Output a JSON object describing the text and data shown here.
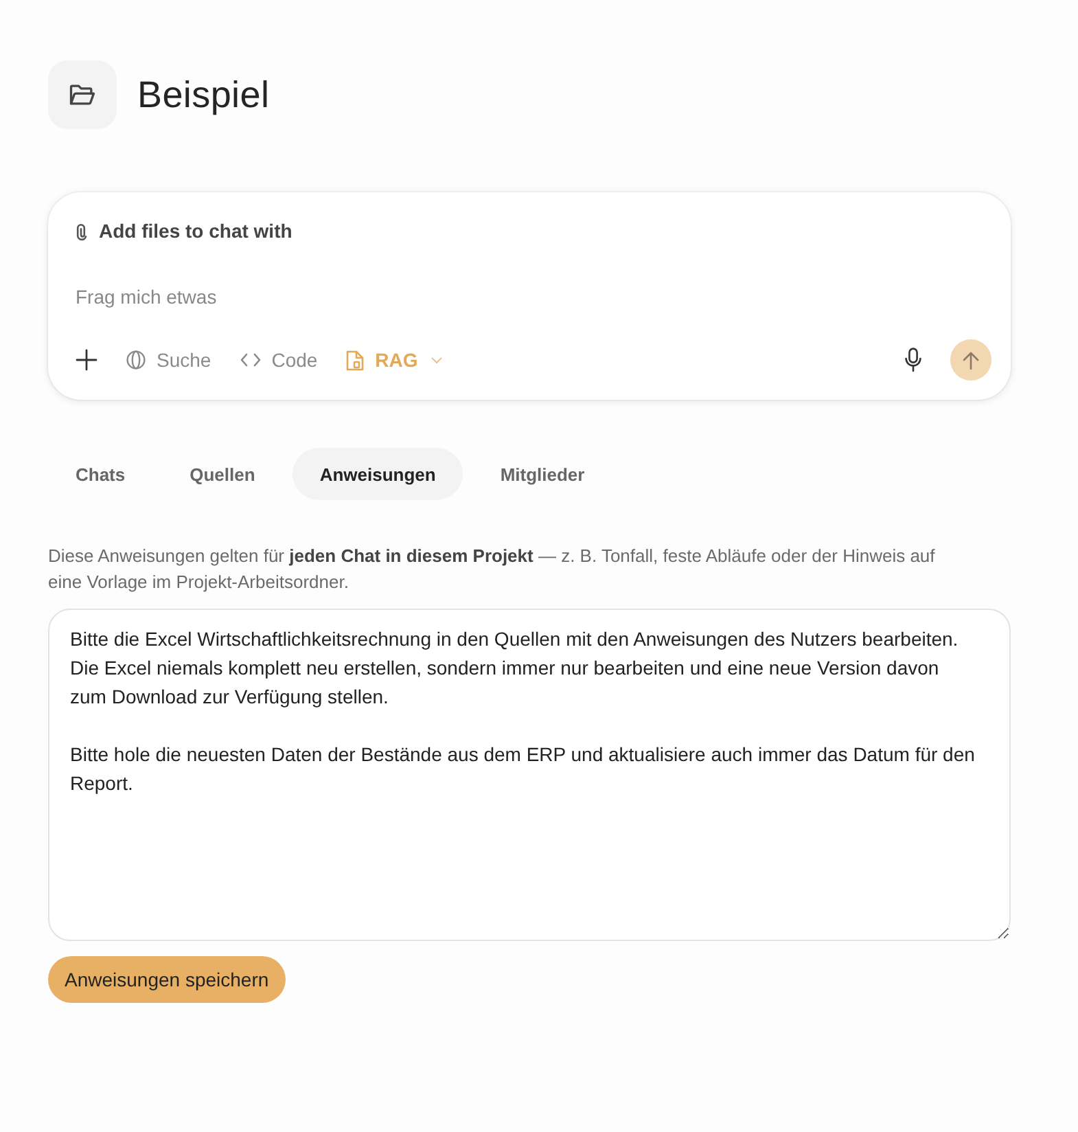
{
  "project": {
    "title": "Beispiel"
  },
  "composer": {
    "attach_label": "Add files to chat with",
    "placeholder": "Frag mich etwas",
    "tools": [
      {
        "kind": "toggle",
        "label": "Suche",
        "selected": false
      },
      {
        "kind": "toggle",
        "label": "Code",
        "selected": false
      },
      {
        "kind": "dropdown",
        "label": "RAG",
        "selected": true
      }
    ],
    "send_button": {
      "disabled": true
    }
  },
  "tabs": [
    {
      "label": "Chats",
      "selected": false
    },
    {
      "label": "Quellen",
      "selected": false
    },
    {
      "label": "Anweisungen",
      "selected": true
    },
    {
      "label": "Mitglieder",
      "selected": false
    }
  ],
  "instructions": {
    "description": "Diese Anweisungen gelten für **jeden Chat in diesem Projekt** — z. B. Tonfall, feste Abläufe oder der Hinweis auf eine Vorlage im Projekt-Arbeitsordner.",
    "value": "Bitte die Excel Wirtschaftlichkeitsrechnung in den Quellen mit den Anweisungen des Nutzers bearbeiten. Die Excel niemals komplett neu erstellen, sondern immer nur bearbeiten und eine neue Version davon zum Download zur Verfügung stellen.\n\nBitte hole die neuesten Daten der Bestände aus dem ERP und aktualisiere auch immer das Datum für den Report.",
    "save_button": "Anweisungen speichern"
  }
}
